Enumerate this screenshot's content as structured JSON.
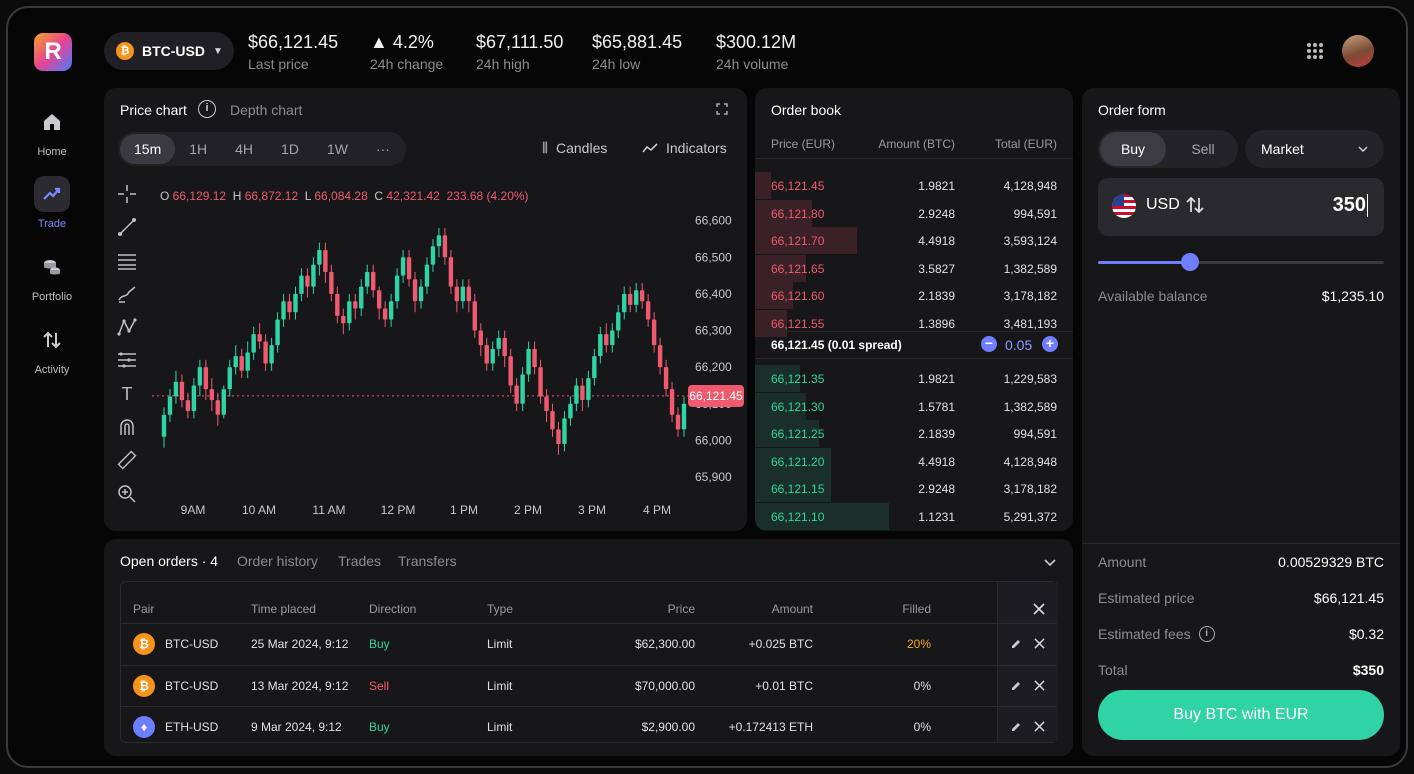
{
  "header": {
    "logo_letter": "R",
    "pair": "BTC-USD",
    "stats": [
      {
        "value": "$66,121.45",
        "label": "Last price"
      },
      {
        "value": "▲ 4.2%",
        "label": "24h change"
      },
      {
        "value": "$67,111.50",
        "label": "24h high"
      },
      {
        "value": "$65,881.45",
        "label": "24h low"
      },
      {
        "value": "$300.12M",
        "label": "24h volume"
      }
    ]
  },
  "sidebar": {
    "items": [
      {
        "label": "Home"
      },
      {
        "label": "Trade"
      },
      {
        "label": "Portfolio"
      },
      {
        "label": "Activity"
      }
    ]
  },
  "chart": {
    "tabs": [
      "Price chart",
      "Depth chart"
    ],
    "intervals": [
      "15m",
      "1H",
      "4H",
      "1D",
      "1W",
      "···"
    ],
    "candles_label": "Candles",
    "indicators_label": "Indicators",
    "ohlc": {
      "o": "66,129.12",
      "h": "66,872.12",
      "l": "66,084.28",
      "c": "42,321.42",
      "chg": "233.68 (4.20%)"
    },
    "current_price_tag": "66,121.45"
  },
  "chart_data": {
    "type": "candlestick",
    "x_ticks": [
      "9AM",
      "10 AM",
      "11 AM",
      "12 PM",
      "1 PM",
      "2 PM",
      "3 PM",
      "4 PM"
    ],
    "y_ticks": [
      "66,600",
      "66,500",
      "66,400",
      "66,300",
      "66,200",
      "66,100",
      "66,000",
      "65,900"
    ],
    "ylim": [
      65870,
      66640
    ],
    "current_price": 66121.45,
    "candles": [
      [
        66010,
        66070,
        65980,
        66090
      ],
      [
        66070,
        66120,
        66050,
        66140
      ],
      [
        66120,
        66160,
        66100,
        66190
      ],
      [
        66160,
        66110,
        66090,
        66180
      ],
      [
        66110,
        66080,
        66060,
        66130
      ],
      [
        66080,
        66150,
        66060,
        66170
      ],
      [
        66150,
        66200,
        66120,
        66220
      ],
      [
        66200,
        66140,
        66110,
        66220
      ],
      [
        66140,
        66110,
        66080,
        66170
      ],
      [
        66110,
        66070,
        66040,
        66130
      ],
      [
        66070,
        66140,
        66060,
        66150
      ],
      [
        66140,
        66200,
        66120,
        66220
      ],
      [
        66200,
        66230,
        66180,
        66260
      ],
      [
        66230,
        66190,
        66170,
        66250
      ],
      [
        66190,
        66240,
        66170,
        66270
      ],
      [
        66240,
        66290,
        66220,
        66310
      ],
      [
        66290,
        66270,
        66250,
        66320
      ],
      [
        66270,
        66210,
        66190,
        66290
      ],
      [
        66210,
        66260,
        66190,
        66280
      ],
      [
        66260,
        66330,
        66240,
        66350
      ],
      [
        66330,
        66380,
        66310,
        66400
      ],
      [
        66380,
        66350,
        66330,
        66400
      ],
      [
        66350,
        66400,
        66330,
        66420
      ],
      [
        66400,
        66450,
        66380,
        66470
      ],
      [
        66450,
        66420,
        66390,
        66470
      ],
      [
        66420,
        66480,
        66400,
        66500
      ],
      [
        66480,
        66520,
        66450,
        66540
      ],
      [
        66520,
        66460,
        66430,
        66540
      ],
      [
        66460,
        66400,
        66380,
        66480
      ],
      [
        66400,
        66340,
        66320,
        66420
      ],
      [
        66340,
        66320,
        66290,
        66360
      ],
      [
        66320,
        66380,
        66300,
        66400
      ],
      [
        66380,
        66360,
        66330,
        66400
      ],
      [
        66360,
        66420,
        66340,
        66440
      ],
      [
        66420,
        66460,
        66400,
        66480
      ],
      [
        66460,
        66410,
        66390,
        66480
      ],
      [
        66410,
        66360,
        66330,
        66420
      ],
      [
        66360,
        66330,
        66310,
        66380
      ],
      [
        66330,
        66380,
        66310,
        66400
      ],
      [
        66380,
        66450,
        66360,
        66470
      ],
      [
        66450,
        66500,
        66430,
        66520
      ],
      [
        66500,
        66440,
        66420,
        66520
      ],
      [
        66440,
        66380,
        66350,
        66460
      ],
      [
        66380,
        66420,
        66360,
        66440
      ],
      [
        66420,
        66480,
        66400,
        66500
      ],
      [
        66480,
        66530,
        66460,
        66550
      ],
      [
        66530,
        66560,
        66500,
        66580
      ],
      [
        66560,
        66500,
        66480,
        66580
      ],
      [
        66500,
        66420,
        66400,
        66520
      ],
      [
        66420,
        66380,
        66350,
        66440
      ],
      [
        66380,
        66420,
        66360,
        66440
      ],
      [
        66420,
        66380,
        66350,
        66440
      ],
      [
        66380,
        66300,
        66280,
        66400
      ],
      [
        66300,
        66260,
        66230,
        66320
      ],
      [
        66260,
        66210,
        66190,
        66280
      ],
      [
        66210,
        66250,
        66190,
        66270
      ],
      [
        66250,
        66280,
        66230,
        66300
      ],
      [
        66280,
        66230,
        66200,
        66300
      ],
      [
        66230,
        66150,
        66130,
        66250
      ],
      [
        66150,
        66100,
        66080,
        66170
      ],
      [
        66100,
        66180,
        66080,
        66200
      ],
      [
        66180,
        66250,
        66160,
        66270
      ],
      [
        66250,
        66200,
        66180,
        66270
      ],
      [
        66200,
        66120,
        66100,
        66220
      ],
      [
        66120,
        66080,
        66050,
        66140
      ],
      [
        66080,
        66030,
        66010,
        66100
      ],
      [
        66030,
        65990,
        65960,
        66050
      ],
      [
        65990,
        66060,
        65970,
        66080
      ],
      [
        66060,
        66100,
        66040,
        66120
      ],
      [
        66100,
        66150,
        66080,
        66170
      ],
      [
        66150,
        66110,
        66080,
        66170
      ],
      [
        66110,
        66170,
        66090,
        66190
      ],
      [
        66170,
        66230,
        66150,
        66250
      ],
      [
        66230,
        66290,
        66210,
        66310
      ],
      [
        66290,
        66260,
        66240,
        66320
      ],
      [
        66260,
        66300,
        66240,
        66320
      ],
      [
        66300,
        66350,
        66280,
        66370
      ],
      [
        66350,
        66400,
        66330,
        66420
      ],
      [
        66400,
        66370,
        66350,
        66420
      ],
      [
        66370,
        66410,
        66350,
        66430
      ],
      [
        66410,
        66380,
        66360,
        66430
      ],
      [
        66380,
        66330,
        66310,
        66400
      ],
      [
        66330,
        66260,
        66240,
        66350
      ],
      [
        66260,
        66200,
        66180,
        66280
      ],
      [
        66200,
        66140,
        66120,
        66220
      ],
      [
        66140,
        66070,
        66050,
        66160
      ],
      [
        66070,
        66030,
        66010,
        66090
      ],
      [
        66030,
        66100,
        66010,
        66120
      ]
    ]
  },
  "order_book": {
    "title": "Order book",
    "headers": [
      "Price (EUR)",
      "Amount (BTC)",
      "Total (EUR)"
    ],
    "asks": [
      {
        "price": "66,121.45",
        "amount": "1.9821",
        "total": "4,128,948",
        "depth": 0.05
      },
      {
        "price": "66,121.80",
        "amount": "2.9248",
        "total": "994,591",
        "depth": 0.18
      },
      {
        "price": "66,121.70",
        "amount": "4.4918",
        "total": "3,593,124",
        "depth": 0.32
      },
      {
        "price": "66,121.65",
        "amount": "3.5827",
        "total": "1,382,589",
        "depth": 0.16
      },
      {
        "price": "66,121.60",
        "amount": "2.1839",
        "total": "3,178,182",
        "depth": 0.12
      },
      {
        "price": "66,121.55",
        "amount": "1.3896",
        "total": "3,481,193",
        "depth": 0.1
      }
    ],
    "spread_label": "66,121.45 (0.01 spread)",
    "step": "0.05",
    "bids": [
      {
        "price": "66,121.35",
        "amount": "1.9821",
        "total": "1,229,583",
        "depth": 0.14
      },
      {
        "price": "66,121.30",
        "amount": "1.5781",
        "total": "1,382,589",
        "depth": 0.16
      },
      {
        "price": "66,121.25",
        "amount": "2.1839",
        "total": "994,591",
        "depth": 0.2
      },
      {
        "price": "66,121.20",
        "amount": "4.4918",
        "total": "4,128,948",
        "depth": 0.24
      },
      {
        "price": "66,121.15",
        "amount": "2.9248",
        "total": "3,178,182",
        "depth": 0.24
      },
      {
        "price": "66,121.10",
        "amount": "1.1231",
        "total": "5,291,372",
        "depth": 0.42
      }
    ]
  },
  "order_form": {
    "title": "Order form",
    "buy_label": "Buy",
    "sell_label": "Sell",
    "order_type": "Market",
    "currency": "USD",
    "amount_value": "350",
    "slider_fraction": 0.32,
    "available_label": "Available balance",
    "available_value": "$1,235.10",
    "summary": [
      {
        "label": "Amount",
        "value": "0.00529329 BTC"
      },
      {
        "label": "Estimated price",
        "value": "$66,121.45"
      },
      {
        "label": "Estimated fees",
        "value": "$0.32"
      },
      {
        "label": "Total",
        "value": "$350"
      }
    ],
    "submit_label": "Buy BTC with EUR"
  },
  "orders": {
    "tabs": [
      "Open orders · 4",
      "Order history",
      "Trades",
      "Transfers"
    ],
    "headers": [
      "Pair",
      "Time placed",
      "Direction",
      "Type",
      "Price",
      "Amount",
      "Filled"
    ],
    "rows": [
      {
        "pair": "BTC-USD",
        "coin": "btc",
        "time": "25 Mar 2024, 9:12",
        "direction": "Buy",
        "type": "Limit",
        "price": "$62,300.00",
        "amount": "+0.025 BTC",
        "filled": "20%"
      },
      {
        "pair": "BTC-USD",
        "coin": "btc",
        "time": "13 Mar 2024, 9:12",
        "direction": "Sell",
        "type": "Limit",
        "price": "$70,000.00",
        "amount": "+0.01 BTC",
        "filled": "0%"
      },
      {
        "pair": "ETH-USD",
        "coin": "eth",
        "time": "9 Mar 2024, 9:12",
        "direction": "Buy",
        "type": "Limit",
        "price": "$2,900.00",
        "amount": "+0.172413 ETH",
        "filled": "0%"
      }
    ]
  },
  "colors": {
    "up": "#2fd3a4",
    "down": "#ef5a6f",
    "accent": "#6f7dff",
    "cta": "#2fd3a4"
  }
}
